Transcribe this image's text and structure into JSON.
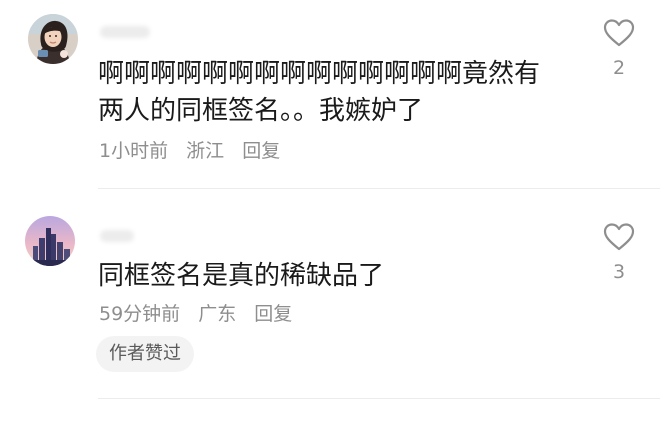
{
  "comments": [
    {
      "text": "啊啊啊啊啊啊啊啊啊啊啊啊啊啊竟然有两人的同框签名。。我嫉妒了",
      "time": "1小时前",
      "location": "浙江",
      "reply_label": "回复",
      "like_count": "2",
      "avatar_icon": "user-avatar-girl",
      "like_icon": "heart-outline-icon"
    },
    {
      "text": "同框签名是真的稀缺品了",
      "time": "59分钟前",
      "location": "广东",
      "reply_label": "回复",
      "author_badge": "作者赞过",
      "like_count": "3",
      "avatar_icon": "user-avatar-city-skyline",
      "like_icon": "heart-outline-icon"
    }
  ],
  "colors": {
    "text_primary": "#1a1a1a",
    "text_secondary": "#8e8e8e",
    "badge_bg": "#f3f3f3",
    "divider": "#ececec"
  }
}
